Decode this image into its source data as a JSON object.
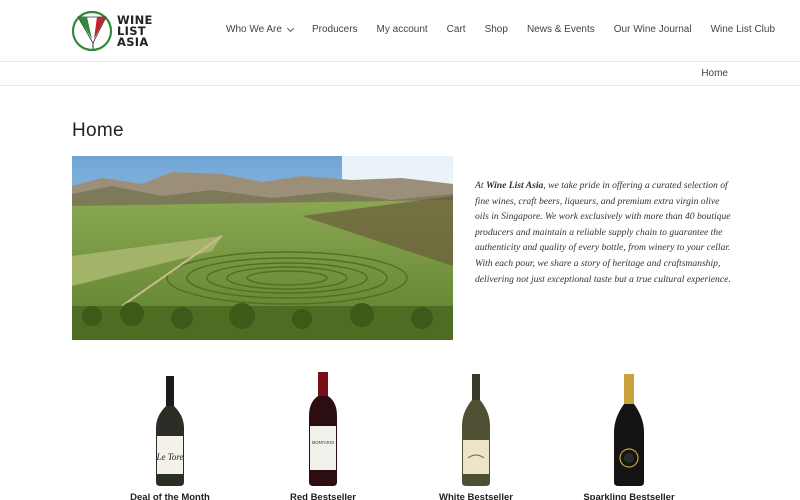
{
  "brand": {
    "line1": "WINE",
    "line2": "LIST",
    "line3": "ASIA"
  },
  "nav": [
    {
      "label": "Who We Are",
      "has_dropdown": true
    },
    {
      "label": "Producers"
    },
    {
      "label": "My account"
    },
    {
      "label": "Cart"
    },
    {
      "label": "Shop"
    },
    {
      "label": "News & Events"
    },
    {
      "label": "Our Wine Journal"
    },
    {
      "label": "Wine List Club"
    }
  ],
  "breadcrumb": "Home",
  "page_title": "Home",
  "intro": {
    "prefix": "At ",
    "brand": "Wine List Asia",
    "body": ", we take pride in offering a curated selection of fine wines, craft beers, liqueurs, and premium extra virgin olive oils in Singapore. We work exclusively with more than 40 boutique producers and maintain a reliable supply chain to guarantee the authenticity and quality of every bottle, from winery to your cellar. With each pour, we share a story of heritage and craftsmanship, delivering not just exceptional taste but a true cultural experience."
  },
  "products": [
    {
      "label": "Deal of the Month",
      "bottle_label": "Le Tore"
    },
    {
      "label": "Red Bestseller",
      "bottle_label": "MONTARIO"
    },
    {
      "label": "White Bestseller",
      "bottle_label": ""
    },
    {
      "label": "Sparkling Bestseller",
      "bottle_label": ""
    }
  ],
  "colors": {
    "logo_green": "#2e8b3a",
    "logo_red": "#c0252a",
    "border": "#ecebd9"
  }
}
